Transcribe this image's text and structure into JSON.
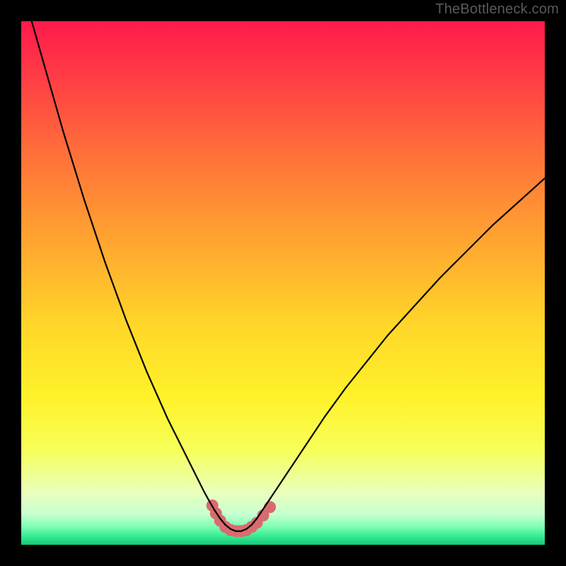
{
  "watermark": "TheBottleneck.com",
  "gradient_stops": [
    {
      "offset": 0.0,
      "color": "#ff1a4c"
    },
    {
      "offset": 0.1,
      "color": "#ff3a45"
    },
    {
      "offset": 0.25,
      "color": "#ff6f3a"
    },
    {
      "offset": 0.42,
      "color": "#ffa530"
    },
    {
      "offset": 0.58,
      "color": "#ffd629"
    },
    {
      "offset": 0.72,
      "color": "#fff22a"
    },
    {
      "offset": 0.82,
      "color": "#f6ff5a"
    },
    {
      "offset": 0.9,
      "color": "#e9ffbc"
    },
    {
      "offset": 0.94,
      "color": "#caffd1"
    },
    {
      "offset": 0.965,
      "color": "#7fffb4"
    },
    {
      "offset": 0.985,
      "color": "#32e98f"
    },
    {
      "offset": 1.0,
      "color": "#16c877"
    }
  ],
  "curve_color": "#000000",
  "curve_width": 2.2,
  "dots_color": "#d96b6f",
  "chart_data": {
    "type": "line",
    "title": "",
    "xlabel": "",
    "ylabel": "",
    "xlim": [
      0,
      100
    ],
    "ylim": [
      0,
      100
    ],
    "x": [
      0,
      2,
      4,
      6,
      8,
      10,
      12,
      14,
      16,
      18,
      20,
      22,
      24,
      26,
      28,
      30,
      32,
      34,
      35,
      36,
      37,
      38,
      39,
      40,
      41,
      42,
      43,
      44,
      45,
      46,
      48,
      50,
      52,
      55,
      58,
      62,
      66,
      70,
      75,
      80,
      85,
      90,
      95,
      100
    ],
    "values": [
      108,
      100,
      93,
      86,
      79,
      72.5,
      66,
      60,
      54,
      48.5,
      43,
      38,
      33,
      28.5,
      24,
      20,
      16,
      12,
      10,
      8.2,
      6.5,
      5.0,
      3.8,
      3.0,
      2.6,
      2.6,
      3.0,
      3.8,
      5.0,
      6.5,
      9.5,
      12.5,
      15.5,
      20,
      24.5,
      30,
      35,
      40,
      45.5,
      51,
      56,
      61,
      65.5,
      70
    ],
    "annotations": {
      "dots": [
        {
          "x": 36.5,
          "y": 7.5
        },
        {
          "x": 37.2,
          "y": 6.0
        },
        {
          "x": 38.0,
          "y": 4.6
        },
        {
          "x": 39.0,
          "y": 3.4
        },
        {
          "x": 40.0,
          "y": 2.8
        },
        {
          "x": 41.0,
          "y": 2.6
        },
        {
          "x": 42.0,
          "y": 2.6
        },
        {
          "x": 43.0,
          "y": 2.8
        },
        {
          "x": 44.0,
          "y": 3.4
        },
        {
          "x": 45.0,
          "y": 4.2
        },
        {
          "x": 46.2,
          "y": 5.6
        },
        {
          "x": 47.5,
          "y": 7.2
        }
      ],
      "dot_radius": 8.5
    }
  }
}
